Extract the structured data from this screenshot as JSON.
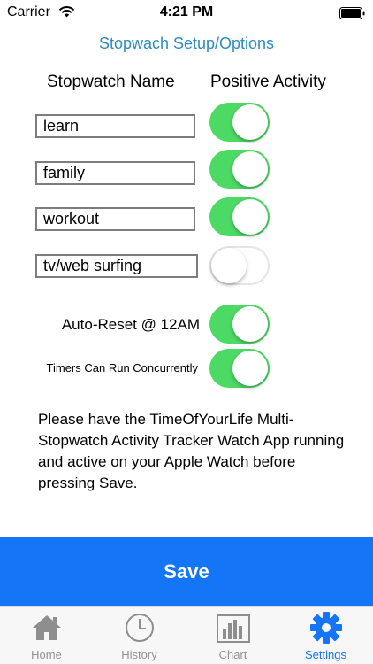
{
  "status_bar": {
    "carrier": "Carrier",
    "time": "4:21 PM"
  },
  "screen": {
    "title": "Stopwach Setup/Options"
  },
  "columns": {
    "name": "Stopwatch Name",
    "activity": "Positive Activity"
  },
  "stopwatches": [
    {
      "name": "learn",
      "positive": true
    },
    {
      "name": "family",
      "positive": true
    },
    {
      "name": "workout",
      "positive": true
    },
    {
      "name": "tv/web surfing",
      "positive": false
    }
  ],
  "options": {
    "auto_reset": {
      "label": "Auto-Reset @ 12AM",
      "on": true
    },
    "concurrent": {
      "label": "Timers Can Run Concurrently",
      "on": true
    }
  },
  "notice": "Please have the TimeOfYourLife Multi-Stopwatch Activity Tracker Watch App running and active on your Apple Watch before pressing Save.",
  "save_label": "Save",
  "tabs": [
    {
      "label": "Home",
      "icon": "home-icon",
      "active": false
    },
    {
      "label": "History",
      "icon": "clock-icon",
      "active": false
    },
    {
      "label": "Chart",
      "icon": "bar-chart-icon",
      "active": false
    },
    {
      "label": "Settings",
      "icon": "gear-icon",
      "active": true
    }
  ],
  "colors": {
    "accent": "#1475f7",
    "switch_on": "#4cd964",
    "title": "#2f8bc0"
  }
}
